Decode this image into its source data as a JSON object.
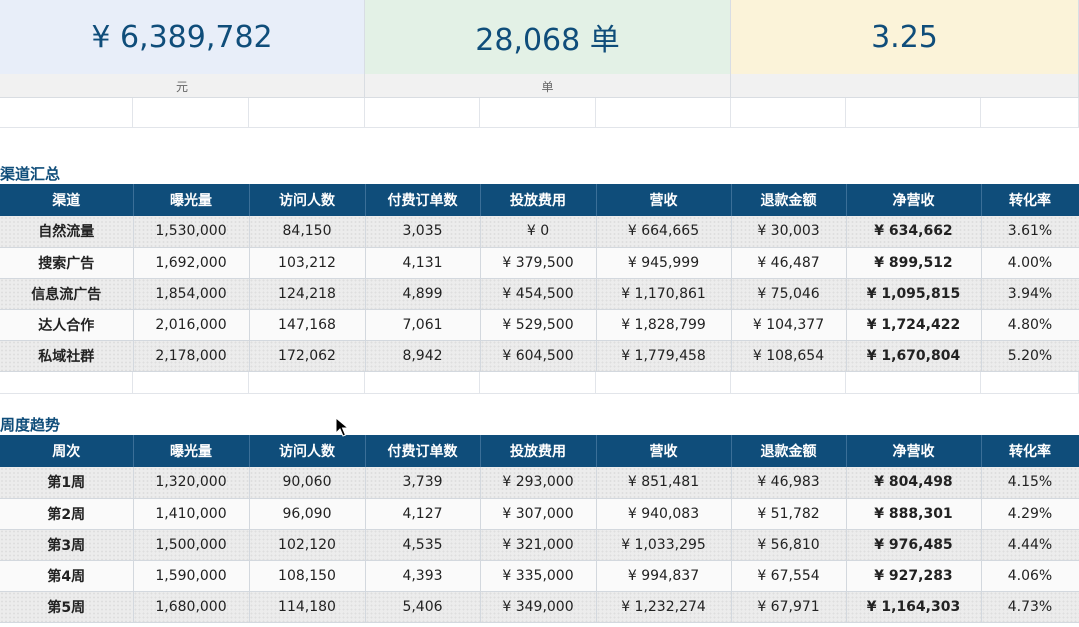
{
  "kpis": [
    {
      "value": "¥ 6,389,782",
      "unit": "元"
    },
    {
      "value": "28,068 单",
      "unit": "单"
    },
    {
      "value": "3.25",
      "unit": ""
    }
  ],
  "channels": {
    "title": "渠道汇总",
    "headers": [
      "渠道",
      "曝光量",
      "访问人数",
      "付费订单数",
      "投放费用",
      "营收",
      "退款金额",
      "净营收",
      "转化率"
    ],
    "rows": [
      [
        "自然流量",
        "1,530,000",
        "84,150",
        "3,035",
        "¥ 0",
        "¥ 664,665",
        "¥ 30,003",
        "¥ 634,662",
        "3.61%"
      ],
      [
        "搜索广告",
        "1,692,000",
        "103,212",
        "4,131",
        "¥ 379,500",
        "¥ 945,999",
        "¥ 46,487",
        "¥ 899,512",
        "4.00%"
      ],
      [
        "信息流广告",
        "1,854,000",
        "124,218",
        "4,899",
        "¥ 454,500",
        "¥ 1,170,861",
        "¥ 75,046",
        "¥ 1,095,815",
        "3.94%"
      ],
      [
        "达人合作",
        "2,016,000",
        "147,168",
        "7,061",
        "¥ 529,500",
        "¥ 1,828,799",
        "¥ 104,377",
        "¥ 1,724,422",
        "4.80%"
      ],
      [
        "私域社群",
        "2,178,000",
        "172,062",
        "8,942",
        "¥ 604,500",
        "¥ 1,779,458",
        "¥ 108,654",
        "¥ 1,670,804",
        "5.20%"
      ]
    ]
  },
  "weekly": {
    "title": "周度趋势",
    "headers": [
      "周次",
      "曝光量",
      "访问人数",
      "付费订单数",
      "投放费用",
      "营收",
      "退款金额",
      "净营收",
      "转化率"
    ],
    "rows": [
      [
        "第1周",
        "1,320,000",
        "90,060",
        "3,739",
        "¥ 293,000",
        "¥ 851,481",
        "¥ 46,983",
        "¥ 804,498",
        "4.15%"
      ],
      [
        "第2周",
        "1,410,000",
        "96,090",
        "4,127",
        "¥ 307,000",
        "¥ 940,083",
        "¥ 51,782",
        "¥ 888,301",
        "4.29%"
      ],
      [
        "第3周",
        "1,500,000",
        "102,120",
        "4,535",
        "¥ 321,000",
        "¥ 1,033,295",
        "¥ 56,810",
        "¥ 976,485",
        "4.44%"
      ],
      [
        "第4周",
        "1,590,000",
        "108,150",
        "4,393",
        "¥ 335,000",
        "¥ 994,837",
        "¥ 67,554",
        "¥ 927,283",
        "4.06%"
      ],
      [
        "第5周",
        "1,680,000",
        "114,180",
        "5,406",
        "¥ 349,000",
        "¥ 1,232,274",
        "¥ 67,971",
        "¥ 1,164,303",
        "4.73%"
      ]
    ]
  }
}
